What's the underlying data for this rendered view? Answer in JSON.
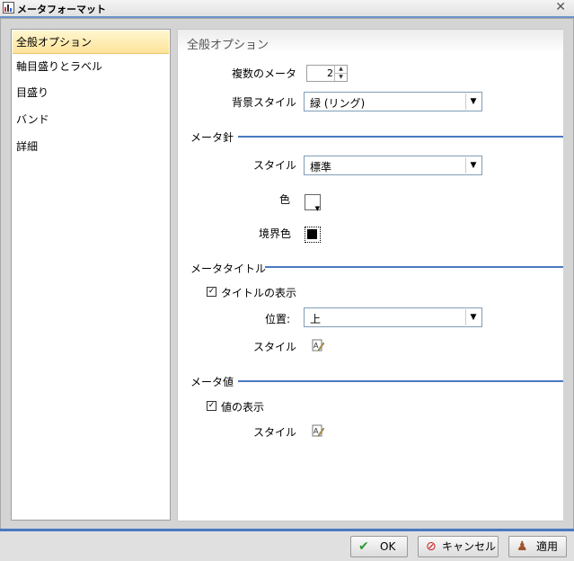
{
  "window": {
    "title": "メータフォーマット"
  },
  "sidebar": {
    "items": [
      {
        "label": "全般オプション",
        "selected": true
      },
      {
        "label": "軸目盛りとラベル",
        "selected": false
      },
      {
        "label": "目盛り",
        "selected": false
      },
      {
        "label": "バンド",
        "selected": false
      },
      {
        "label": "詳細",
        "selected": false
      }
    ]
  },
  "main": {
    "title": "全般オプション",
    "multiple_meters": {
      "label": "複数のメータ",
      "value": "2"
    },
    "background_style": {
      "label": "背景スタイル",
      "value": "緑 (リング)"
    },
    "needle": {
      "section": "メータ針",
      "style_label": "スタイル",
      "style_value": "標準",
      "color_label": "色",
      "border_color_label": "境界色"
    },
    "meter_title": {
      "section": "メータタイトル",
      "show_label": "タイトルの表示",
      "show_checked": true,
      "position_label": "位置:",
      "position_value": "上",
      "style_label": "スタイル"
    },
    "meter_value": {
      "section": "メータ値",
      "show_label": "値の表示",
      "show_checked": true,
      "style_label": "スタイル"
    }
  },
  "buttons": {
    "ok": "OK",
    "cancel": "キャンセル",
    "apply": "適用"
  },
  "colors": {
    "accent": "#4a78c0",
    "selected_bg": "#fde39a",
    "needle_color": "#ffffff",
    "needle_border_color": "#000000"
  }
}
